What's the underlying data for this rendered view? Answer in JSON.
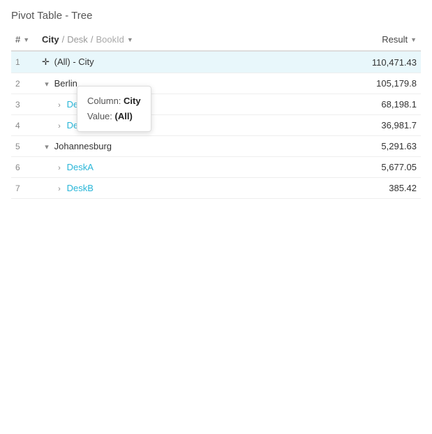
{
  "title": "Pivot Table - Tree",
  "table": {
    "columns": {
      "num_label": "#",
      "city_label": "City",
      "desk_label": "Desk",
      "sep": "/",
      "bookid_label": "BookId",
      "result_label": "Result"
    },
    "rows": [
      {
        "num": "1",
        "indent": false,
        "expand": "",
        "label": "(All) - City",
        "link": false,
        "result": "110,471.43",
        "highlighted": true
      },
      {
        "num": "2",
        "indent": false,
        "expand": "▾",
        "label": "Berlin",
        "link": false,
        "result": "105,179.8",
        "highlighted": false
      },
      {
        "num": "3",
        "indent": true,
        "expand": "›",
        "label": "DeskA",
        "link": true,
        "result": "68,198.1",
        "highlighted": false
      },
      {
        "num": "4",
        "indent": true,
        "expand": "›",
        "label": "DeskB",
        "link": true,
        "result": "36,981.7",
        "highlighted": false
      },
      {
        "num": "5",
        "indent": false,
        "expand": "▾",
        "label": "Johannesburg",
        "link": false,
        "result": "5,291.63",
        "highlighted": false
      },
      {
        "num": "6",
        "indent": true,
        "expand": "›",
        "label": "DeskA",
        "link": true,
        "result": "5,677.05",
        "highlighted": false
      },
      {
        "num": "7",
        "indent": true,
        "expand": "›",
        "label": "DeskB",
        "link": true,
        "result": "385.42",
        "highlighted": false
      }
    ]
  },
  "tooltip": {
    "column_label": "Column:",
    "column_value": "City",
    "value_label": "Value:",
    "value_value": "(All)"
  }
}
